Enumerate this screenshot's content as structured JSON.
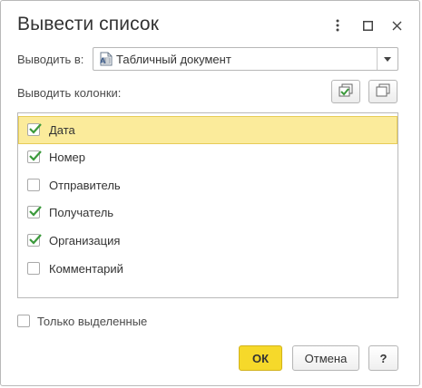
{
  "dialog": {
    "title": "Вывести список",
    "icons": {
      "more": "more-vertical-icon",
      "maximize": "maximize-icon",
      "close": "close-icon"
    }
  },
  "output": {
    "label": "Выводить в:",
    "value": "Табличный документ",
    "icon": "spreadsheet-document-icon"
  },
  "columns": {
    "label": "Выводить колонки:",
    "check_all_icon": "check-all-icon",
    "uncheck_all_icon": "uncheck-all-icon",
    "items": [
      {
        "label": "Дата",
        "checked": true,
        "selected": true
      },
      {
        "label": "Номер",
        "checked": true,
        "selected": false
      },
      {
        "label": "Отправитель",
        "checked": false,
        "selected": false
      },
      {
        "label": "Получатель",
        "checked": true,
        "selected": false
      },
      {
        "label": "Организация",
        "checked": true,
        "selected": false
      },
      {
        "label": "Комментарий",
        "checked": false,
        "selected": false
      }
    ]
  },
  "only_selected": {
    "label": "Только выделенные",
    "checked": false
  },
  "buttons": {
    "ok": "ОК",
    "cancel": "Отмена",
    "help": "?"
  },
  "colors": {
    "accent": "#f6d92a",
    "selection": "#fbeb9b",
    "check": "#3c9a3c"
  }
}
